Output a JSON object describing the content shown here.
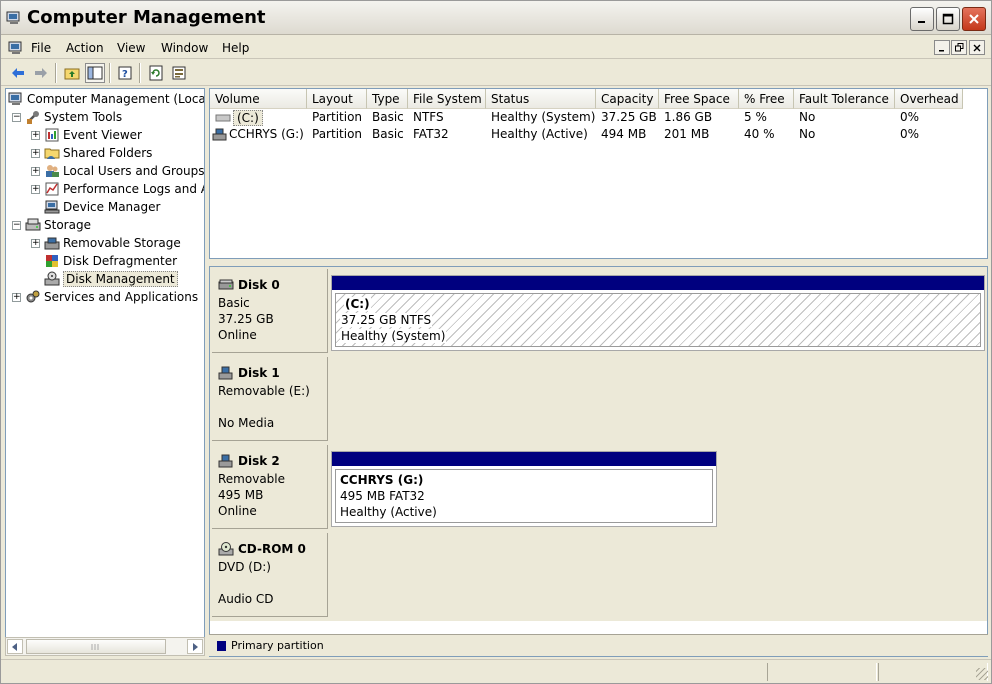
{
  "window": {
    "title": "Computer Management",
    "minimize_label": "_",
    "maximize_label": "□",
    "close_label": "✕"
  },
  "menu": {
    "items": [
      {
        "name": "file",
        "label": "File"
      },
      {
        "name": "action",
        "label": "Action"
      },
      {
        "name": "view",
        "label": "View"
      },
      {
        "name": "window",
        "label": "Window"
      },
      {
        "name": "help",
        "label": "Help"
      }
    ]
  },
  "toolbar": {
    "tools": [
      "back-icon",
      "forward-icon",
      "up-folder-icon",
      "show-hide-tree-icon",
      "help-icon",
      "refresh-icon",
      "properties-icon"
    ]
  },
  "tree": {
    "items": [
      {
        "label": "Computer Management (Local)",
        "icon": "computer-icon",
        "expander": ""
      },
      {
        "label": "System Tools",
        "icon": "tools-icon",
        "expander": "−"
      },
      {
        "label": "Event Viewer",
        "icon": "event-viewer-icon",
        "expander": "+"
      },
      {
        "label": "Shared Folders",
        "icon": "shared-folders-icon",
        "expander": "+"
      },
      {
        "label": "Local Users and Groups",
        "icon": "users-icon",
        "expander": "+"
      },
      {
        "label": "Performance Logs and Alerts",
        "icon": "performance-icon",
        "expander": "+"
      },
      {
        "label": "Device Manager",
        "icon": "device-manager-icon",
        "expander": ""
      },
      {
        "label": "Storage",
        "icon": "storage-icon",
        "expander": "−"
      },
      {
        "label": "Removable Storage",
        "icon": "removable-storage-icon",
        "expander": "+"
      },
      {
        "label": "Disk Defragmenter",
        "icon": "defragmenter-icon",
        "expander": ""
      },
      {
        "label": "Disk Management",
        "icon": "disk-management-icon",
        "expander": "",
        "selected": true
      },
      {
        "label": "Services and Applications",
        "icon": "services-icon",
        "expander": "+"
      }
    ]
  },
  "volumes": {
    "columns": [
      "Volume",
      "Layout",
      "Type",
      "File System",
      "Status",
      "Capacity",
      "Free Space",
      "% Free",
      "Fault Tolerance",
      "Overhead"
    ],
    "rows": [
      [
        "(C:)",
        "Partition",
        "Basic",
        "NTFS",
        "Healthy (System)",
        "37.25 GB",
        "1.86 GB",
        "5 %",
        "No",
        "0%"
      ],
      [
        "CCHRYS (G:)",
        "Partition",
        "Basic",
        "FAT32",
        "Healthy (Active)",
        "494 MB",
        "201 MB",
        "40 %",
        "No",
        "0%"
      ]
    ]
  },
  "disks": [
    {
      "name": "Disk 0",
      "line1": "Basic",
      "line2": "37.25 GB",
      "line3": "Online",
      "icon": "hard-disk-icon",
      "partition": {
        "name": "(C:)",
        "size": "37.25 GB NTFS",
        "status": "Healthy (System)"
      }
    },
    {
      "name": "Disk 1",
      "line1": "Removable (E:)",
      "line2": "",
      "line3": "No Media",
      "icon": "removable-disk-icon"
    },
    {
      "name": "Disk 2",
      "line1": "Removable",
      "line2": "495 MB",
      "line3": "Online",
      "icon": "removable-disk-icon",
      "partition": {
        "name": "CCHRYS  (G:)",
        "size": "495 MB FAT32",
        "status": "Healthy (Active)"
      }
    },
    {
      "name": "CD-ROM 0",
      "line1": "DVD (D:)",
      "line2": "",
      "line3": "Audio CD",
      "icon": "cdrom-icon"
    }
  ],
  "legend": {
    "label": "Primary partition",
    "color": "#00007f"
  }
}
